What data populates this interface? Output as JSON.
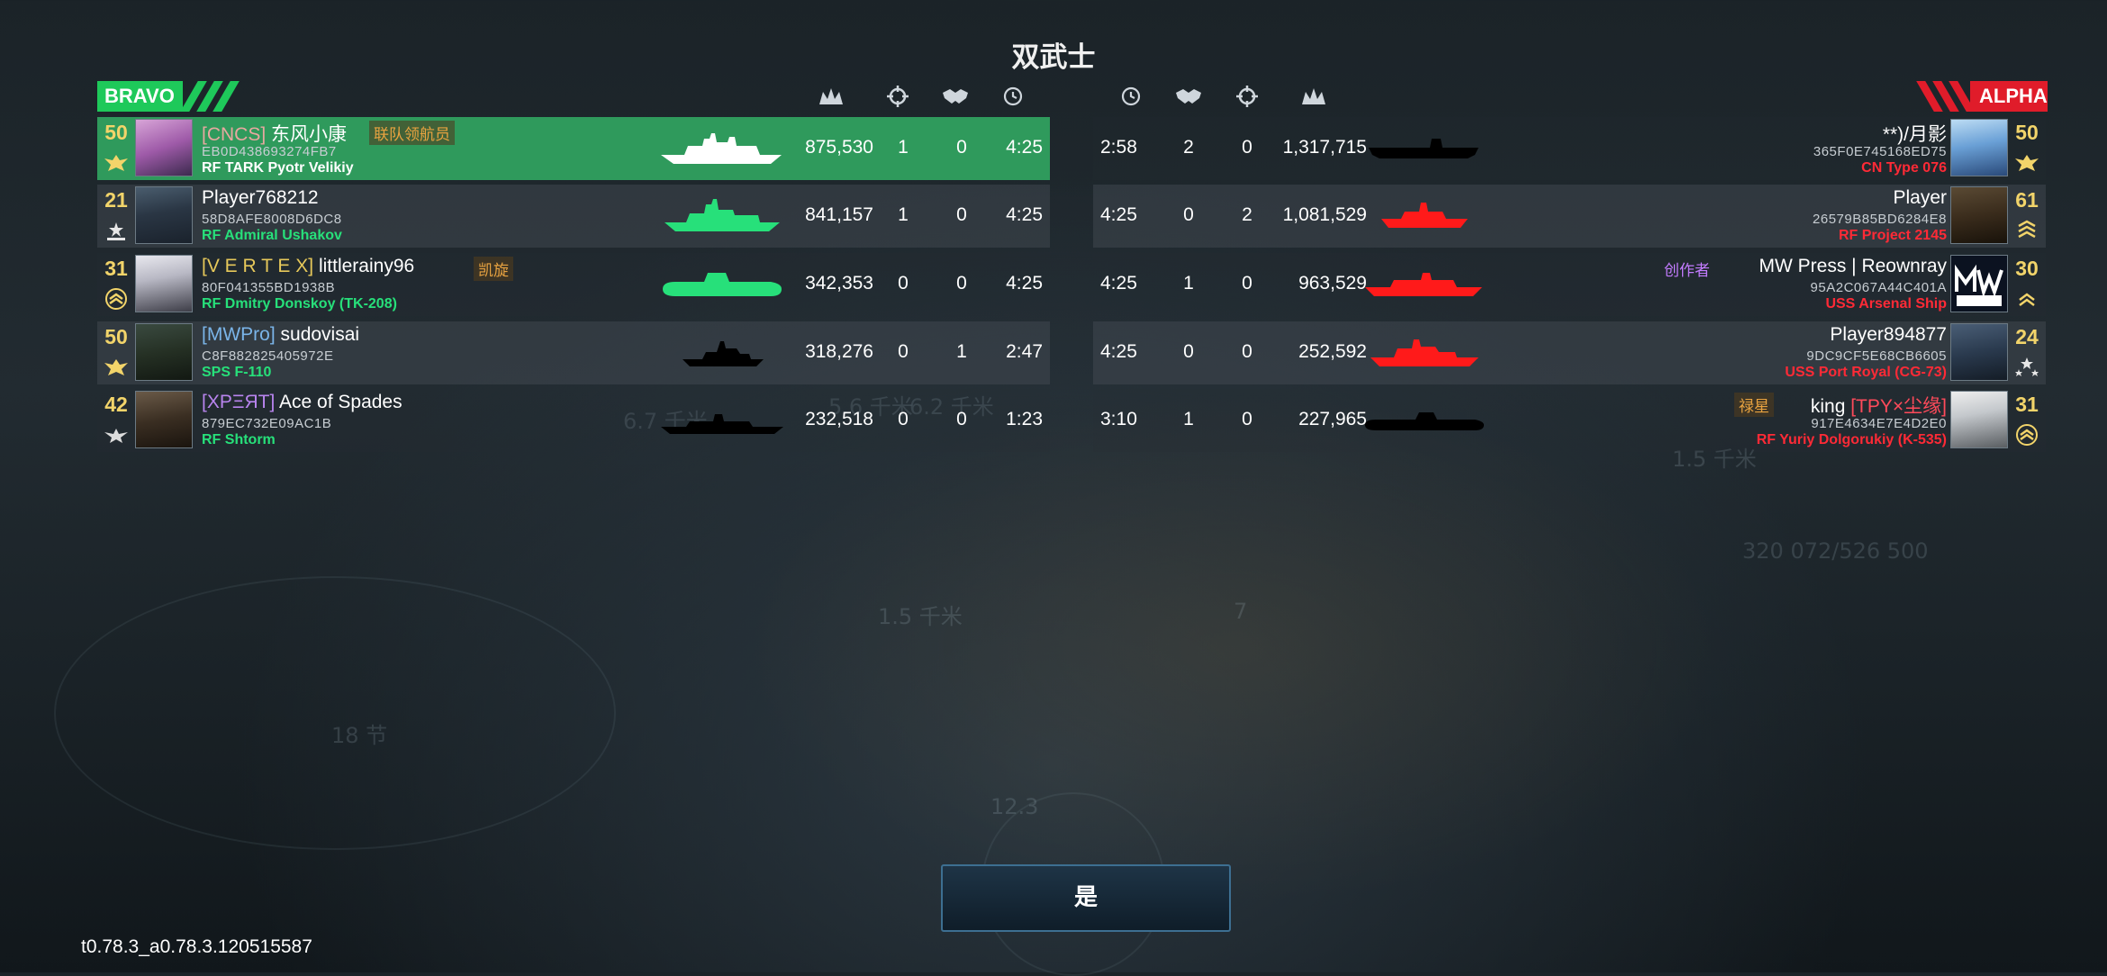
{
  "title": "双武士",
  "teams": {
    "left": "BRAVO",
    "right": "ALPHA"
  },
  "colors": {
    "bravo": "#1ec95a",
    "alpha": "#e01c2a",
    "ship_green": "#27e07a",
    "ship_red": "#ff2a36",
    "level": "#f2d46a"
  },
  "header_icons_left": [
    "damage-icon",
    "crosshair-icon",
    "handshake-icon",
    "clock-icon"
  ],
  "header_icons_right": [
    "clock-icon",
    "handshake-icon",
    "crosshair-icon",
    "damage-icon"
  ],
  "bravo": [
    {
      "level": "50",
      "clan": "[CNCS]",
      "name": "东风小康",
      "badge": "联队领航员",
      "id": "EB0D438693274FB7",
      "ship": "RF TARK Pyotr Velikiy",
      "damage": "875,530",
      "kills": "1",
      "assists": "0",
      "time": "4:25"
    },
    {
      "level": "21",
      "clan": "",
      "name": "Player768212",
      "badge": "",
      "id": "58D8AFE8008D6DC8",
      "ship": "RF Admiral Ushakov",
      "damage": "841,157",
      "kills": "1",
      "assists": "0",
      "time": "4:25"
    },
    {
      "level": "31",
      "clan": "[V E R T E X]",
      "name": "littlerainy96",
      "badge": "凯旋",
      "id": "80F041355BD1938B",
      "ship": "RF Dmitry Donskoy (TK-208)",
      "damage": "342,353",
      "kills": "0",
      "assists": "0",
      "time": "4:25"
    },
    {
      "level": "50",
      "clan": "[MWPro]",
      "name": "sudovisai",
      "badge": "",
      "id": "C8F882825405972E",
      "ship": "SPS F-110",
      "damage": "318,276",
      "kills": "0",
      "assists": "1",
      "time": "2:47"
    },
    {
      "level": "42",
      "clan": "[XPΞЯT]",
      "name": "Ace of Spades",
      "badge": "",
      "id": "879EC732E09AC1B",
      "ship": "RF Shtorm",
      "damage": "232,518",
      "kills": "0",
      "assists": "0",
      "time": "1:23"
    }
  ],
  "alpha": [
    {
      "level": "50",
      "clan": "",
      "name": "**)/月影",
      "badge": "",
      "id": "365F0E745168ED75",
      "ship": "CN Type 076",
      "damage": "1,317,715",
      "kills": "0",
      "assists": "2",
      "time": "2:58"
    },
    {
      "level": "61",
      "clan": "",
      "name": "Player",
      "badge": "",
      "id": "26579B85BD6284E8",
      "ship": "RF Project 2145",
      "damage": "1,081,529",
      "kills": "2",
      "assists": "0",
      "time": "4:25"
    },
    {
      "level": "30",
      "clan": "",
      "name": "MW Press | Reownray",
      "badge": "创作者",
      "id": "95A2C067A44C401A",
      "ship": "USS Arsenal Ship",
      "damage": "963,529",
      "kills": "0",
      "assists": "1",
      "time": "4:25"
    },
    {
      "level": "24",
      "clan": "",
      "name": "Player894877",
      "badge": "",
      "id": "9DC9CF5E68CB6605",
      "ship": "USS Port Royal (CG-73)",
      "damage": "252,592",
      "kills": "0",
      "assists": "0",
      "time": "4:25"
    },
    {
      "level": "31",
      "clan": "[TPY×尘缘]",
      "name": "king",
      "badge": "禄星",
      "id": "917E4634E7E4D2E0",
      "ship": "RF Yuriy Dolgorukiy (K-535)",
      "damage": "227,965",
      "kills": "0",
      "assists": "1",
      "time": "3:10"
    }
  ],
  "confirm_label": "是",
  "version": "t0.78.3_a0.78.3.120515587",
  "bg_labels": [
    "6.7 千米",
    "5.6 千米",
    "6.2 千米",
    "1.5 千米",
    "1.5 千米",
    "18 节",
    "12.3",
    "7",
    "320 072/526 500"
  ]
}
